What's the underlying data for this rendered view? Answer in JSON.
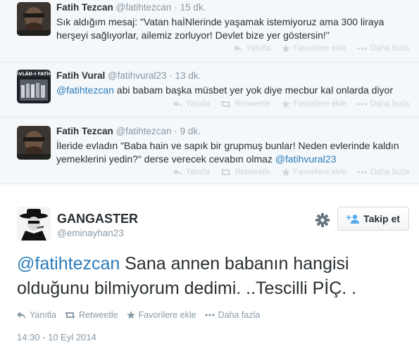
{
  "replies": [
    {
      "fullname": "Fatih Tezcan",
      "handle": "@fatihtezcan",
      "time": "15 dk.",
      "text": "Sık aldığım mesaj: \"Vatan haİNlerinde yaşamak istemiyoruz ama 300 liraya herşeyi sağlıyorlar, ailemiz zorluyor! Devlet bize yer göstersin!\"",
      "actions": [
        "Yanıtla",
        "Favorilere ekle",
        "Daha fazla"
      ]
    },
    {
      "fullname": "Fatih Vural",
      "handle": "@fatihvural23",
      "time": "13 dk.",
      "avatar_text": "EVLÂD-I FATİH",
      "mention": "@fatihtezcan",
      "text": " abi babam başka müsbet yer yok diye mecbur kal onlarda diyor",
      "actions": [
        "Yanıtla",
        "Retweetle",
        "Favorilere ekle",
        "Daha fazla"
      ]
    },
    {
      "fullname": "Fatih Tezcan",
      "handle": "@fatihtezcan",
      "time": "9 dk.",
      "text": "İleride evladın \"Baba hain ve sapık bir grupmuş bunlar! Neden evlerinde kaldın yemeklerini yedin?\" derse verecek cevabın olmaz ",
      "mention": "@fatihvural23",
      "actions": [
        "Yanıtla",
        "Retweetle",
        "Favorilere ekle",
        "Daha fazla"
      ]
    }
  ],
  "main_tweet": {
    "fullname": "GANGASTER",
    "handle": "@eminayhan23",
    "follow_label": "Takip et",
    "mention": "@fatihtezcan",
    "text": " Sana annen babanın hangisi olduğunu bilmiyorum dedimi. ..Tescilli PİÇ. .",
    "actions": [
      "Yanıtla",
      "Retweetle",
      "Favorilere ekle",
      "Daha fazla"
    ],
    "timestamp": "14:30 - 10 Eyl 2014"
  },
  "colors": {
    "link": "#2b7bb9",
    "muted": "#8899a6",
    "faded_action": "#ccd6dd",
    "conversation_bg": "#f5f8fa",
    "follow_icon": "#55acee"
  },
  "icons": [
    "reply-icon",
    "retweet-icon",
    "favorite-star-icon",
    "more-dots-icon",
    "gear-icon",
    "follow-person-icon"
  ]
}
